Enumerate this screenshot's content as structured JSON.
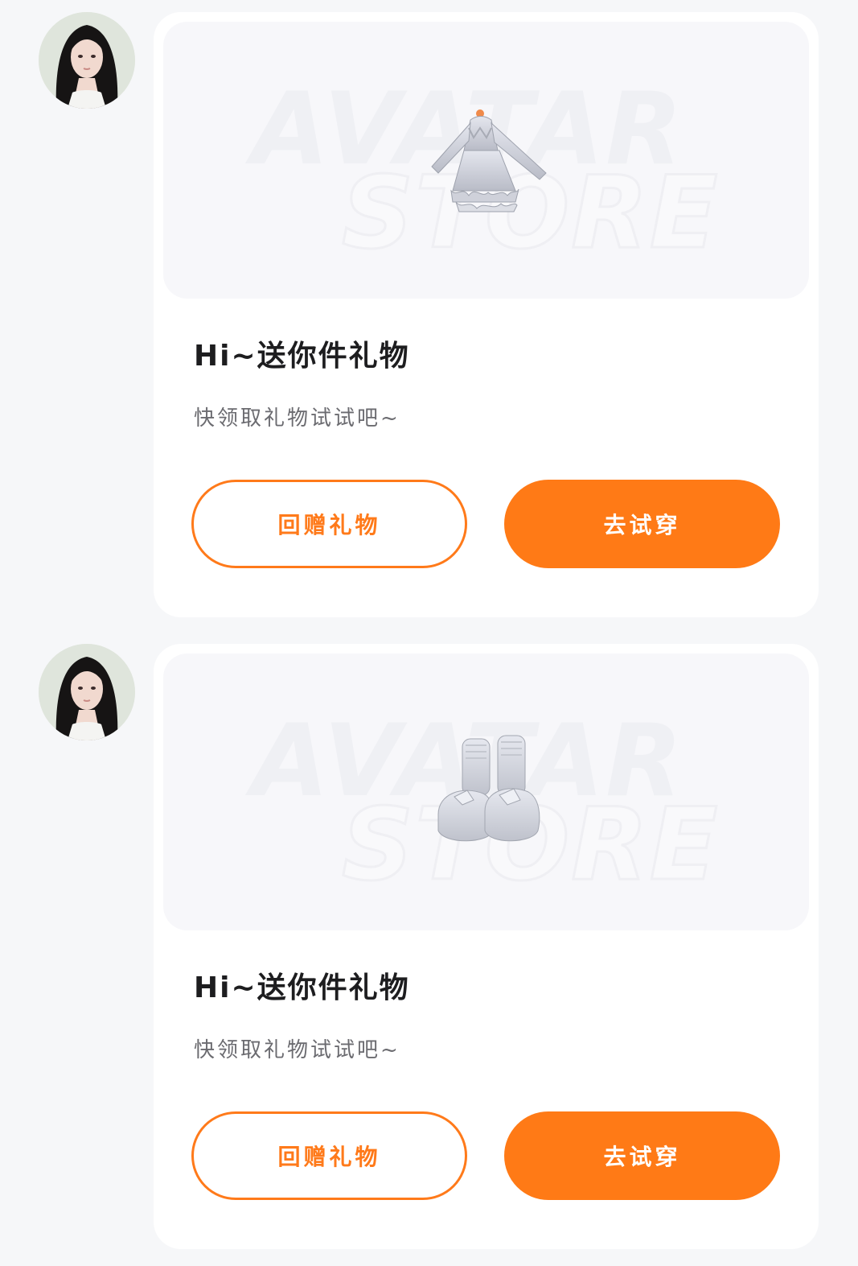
{
  "colors": {
    "accent": "#ff7a16",
    "background": "#f6f7f9",
    "card": "#ffffff",
    "title": "#1d1d1f",
    "subtitle": "#6b6b70"
  },
  "watermark": {
    "line1": "AVATAR",
    "line2": "STORE"
  },
  "messages": [
    {
      "avatar_icon": "user-avatar-photo",
      "item_icon": "dress-icon",
      "title": "Hi~送你件礼物",
      "subtitle": "快领取礼物试试吧~",
      "gift_back_label": "回赠礼物",
      "try_on_label": "去试穿"
    },
    {
      "avatar_icon": "user-avatar-photo",
      "item_icon": "shoes-icon",
      "title": "Hi~送你件礼物",
      "subtitle": "快领取礼物试试吧~",
      "gift_back_label": "回赠礼物",
      "try_on_label": "去试穿"
    }
  ]
}
